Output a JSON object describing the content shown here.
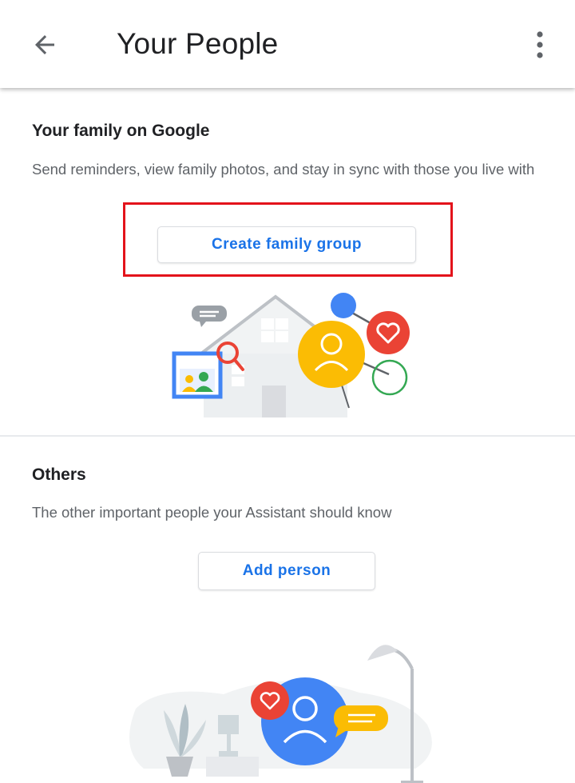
{
  "appbar": {
    "title": "Your People",
    "back_icon": "arrow-back-icon",
    "more_icon": "more-vert-icon"
  },
  "family": {
    "heading": "Your family on Google",
    "description": "Send reminders, view family photos, and stay in sync with those you live with",
    "create_button_label": "Create family group",
    "illustration_icon": "family-house-illustration"
  },
  "others": {
    "heading": "Others",
    "description": "The other important people your Assistant should know",
    "add_button_label": "Add person",
    "illustration_icon": "person-lamp-illustration"
  },
  "colors": {
    "accent_blue": "#1a73e8",
    "highlight_red": "#e3131b",
    "google_red": "#ea4335",
    "google_yellow": "#fbbc04",
    "google_green": "#34a853",
    "google_blue": "#4285f4"
  }
}
